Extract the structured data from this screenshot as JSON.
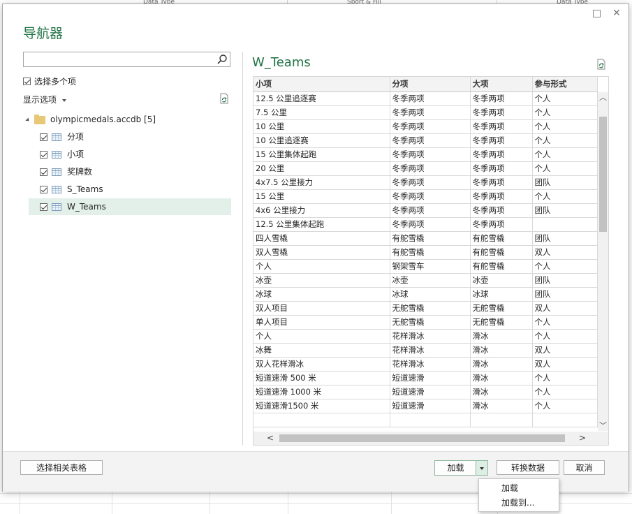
{
  "background": {
    "column_headers": [
      "Data Type",
      "Sport & Fill",
      "Data Type"
    ]
  },
  "dialog": {
    "title": "导航器",
    "search": {
      "value": "",
      "placeholder": ""
    },
    "multi_select_label": "选择多个项",
    "display_options_label": "显示选项",
    "tree": {
      "root": "olympicmedals.accdb [5]",
      "items": [
        {
          "label": "分项",
          "checked": true,
          "selected": false
        },
        {
          "label": "小项",
          "checked": true,
          "selected": false
        },
        {
          "label": "奖牌数",
          "checked": true,
          "selected": false
        },
        {
          "label": "S_Teams",
          "checked": true,
          "selected": false
        },
        {
          "label": "W_Teams",
          "checked": true,
          "selected": true
        }
      ]
    },
    "preview": {
      "title": "W_Teams",
      "columns": [
        "小项",
        "分项",
        "大项",
        "参与形式"
      ],
      "rows": [
        [
          "12.5 公里追逐赛",
          "冬季两项",
          "冬季两项",
          "个人"
        ],
        [
          "7.5 公里",
          "冬季两项",
          "冬季两项",
          "个人"
        ],
        [
          "10 公里",
          "冬季两项",
          "冬季两项",
          "个人"
        ],
        [
          "10 公里追逐赛",
          "冬季两项",
          "冬季两项",
          "个人"
        ],
        [
          "15 公里集体起跑",
          "冬季两项",
          "冬季两项",
          "个人"
        ],
        [
          "20 公里",
          "冬季两项",
          "冬季两项",
          "个人"
        ],
        [
          "4x7.5 公里接力",
          "冬季两项",
          "冬季两项",
          "团队"
        ],
        [
          "15 公里",
          "冬季两项",
          "冬季两项",
          "个人"
        ],
        [
          "4x6 公里接力",
          "冬季两项",
          "冬季两项",
          "团队"
        ],
        [
          "12.5 公里集体起跑",
          "冬季两项",
          "冬季两项",
          ""
        ],
        [
          "四人雪橇",
          "有舵雪橇",
          "有舵雪橇",
          "团队"
        ],
        [
          "双人雪橇",
          "有舵雪橇",
          "有舵雪橇",
          "双人"
        ],
        [
          "个人",
          "钢架雪车",
          "有舵雪橇",
          "个人"
        ],
        [
          "冰壶",
          "冰壶",
          "冰壶",
          "团队"
        ],
        [
          "冰球",
          "冰球",
          "冰球",
          "团队"
        ],
        [
          "双人项目",
          "无舵雪橇",
          "无舵雪橇",
          "双人"
        ],
        [
          "单人项目",
          "无舵雪橇",
          "无舵雪橇",
          "个人"
        ],
        [
          "个人",
          "花样滑冰",
          "滑冰",
          "个人"
        ],
        [
          "冰舞",
          "花样滑冰",
          "滑冰",
          "双人"
        ],
        [
          "双人花样滑冰",
          "花样滑冰",
          "滑冰",
          "双人"
        ],
        [
          "短道速滑 500 米",
          "短道速滑",
          "滑冰",
          "个人"
        ],
        [
          "短道速滑 1000 米",
          "短道速滑",
          "滑冰",
          "个人"
        ],
        [
          "短道速滑1500 米",
          "短道速滑",
          "滑冰",
          "个人"
        ],
        [
          "",
          "",
          "",
          ""
        ]
      ]
    },
    "buttons": {
      "select_related": "选择相关表格",
      "load": "加载",
      "transform": "转换数据",
      "cancel": "取消"
    },
    "load_menu": [
      "加载",
      "加载到..."
    ]
  },
  "colors": {
    "accent": "#217346",
    "selected_row": "#e3f0ea"
  }
}
